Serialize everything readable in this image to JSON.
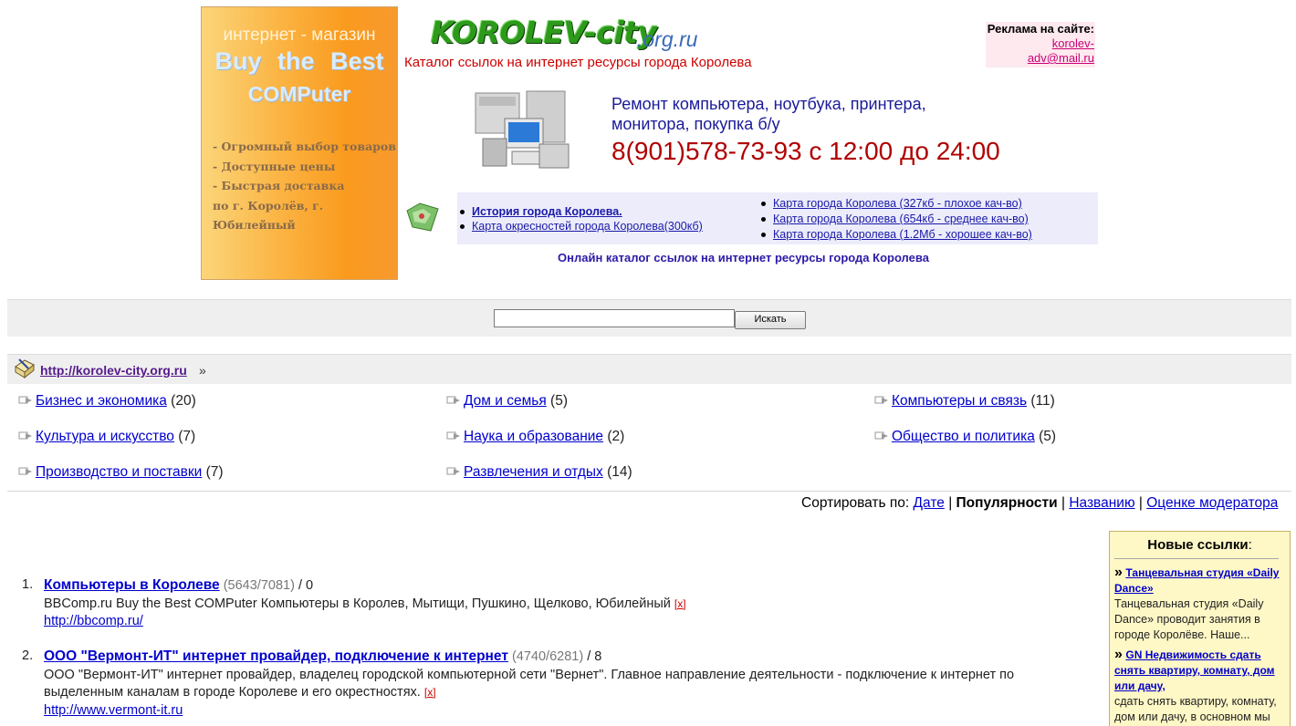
{
  "banner_left": {
    "line1": "интернет - магазин",
    "line2": "Buy the Best",
    "line3": "COMPuter",
    "bullets": [
      "- Огромный выбор товаров",
      "- Доступные цены",
      "- Быстрая доставка",
      "по г. Королёв, г. Юбилейный"
    ]
  },
  "logo": {
    "name": "KOROLEV-city",
    "domain": ".org.ru"
  },
  "tagline": "Каталог ссылок на интернет ресурсы города Королева",
  "ad": {
    "label": "Реклама на сайте:",
    "email": "korolev-adv@mail.ru"
  },
  "repair": {
    "line1": "Ремонт компьютера, ноутбука, принтера,",
    "line2": "монитора, покупка б/у",
    "phone": "8(901)578-73-93 с 12:00 до 24:00"
  },
  "links_left": [
    {
      "label": "История города Королева.",
      "bold": true
    },
    {
      "label": "Карта окресностей города Королева(300кб)",
      "bold": false
    }
  ],
  "links_right": [
    "Карта города Королева (327кб - плохое кач-во)",
    "Карта города Королева (654кб - среднее кач-во)",
    "Карта города Королева (1.2Мб - хорошее кач-во)"
  ],
  "catalog_caption": "Онлайн каталог ссылок на интернет ресурсы города Королева",
  "search": {
    "value": "",
    "button": "Искать"
  },
  "breadcrumb": {
    "link": "http://korolev-city.org.ru",
    "sep": "»"
  },
  "categories": [
    {
      "label": "Бизнес и экономика",
      "count": "(20)"
    },
    {
      "label": "Дом и семья",
      "count": "(5)"
    },
    {
      "label": "Компьютеры и связь",
      "count": "(11)"
    },
    {
      "label": "Культура и искусство",
      "count": "(7)"
    },
    {
      "label": "Наука и образование",
      "count": "(2)"
    },
    {
      "label": "Общество и политика",
      "count": "(5)"
    },
    {
      "label": "Производство и поставки",
      "count": "(7)"
    },
    {
      "label": "Развлечения и отдых",
      "count": "(14)"
    }
  ],
  "sort": {
    "label": "Сортировать по:",
    "date": "Дате",
    "popularity": "Популярности",
    "name": "Названию",
    "moderator": "Оценке модератора",
    "sep": "|"
  },
  "new_links": {
    "title": "Новые ссылки",
    "colon": ":",
    "items": [
      {
        "title": "Танцевальная студия «Daily Dance»",
        "text": "Танцевальная студия «Daily Dance» проводит занятия в городе Королёве. Наше..."
      },
      {
        "title": "GN Недвижимость сдать снять квартиру, комнату, дом или дачу,",
        "text": "сдать снять квартиру, комнату, дом или дачу, в основном мы"
      }
    ]
  },
  "results": [
    {
      "num": "1.",
      "title": "Компьютеры в Королеве",
      "stats": "(5643/7081)",
      "score": "/ 0",
      "desc": "BBComp.ru Buy the Best COMPuter Компьютеры в Королев, Мытищи, Пушкино, Щелково, Юбилейный",
      "x": "[x]",
      "url": "http://bbcomp.ru/"
    },
    {
      "num": "2.",
      "title": "ООО \"Вермонт-ИТ\" интернет провайдер, подключение к интернет",
      "stats": "(4740/6281)",
      "score": "/ 8",
      "desc": "ООО \"Вермонт-ИТ\" интернет провайдер, владелец городской компьютерной сети \"Вернет\". Главное направление деятельности - подключение к интернет по выделенным каналам в городе Королеве и его окрестностях.",
      "x": "[x]",
      "url": "http://www.vermont-it.ru"
    }
  ]
}
